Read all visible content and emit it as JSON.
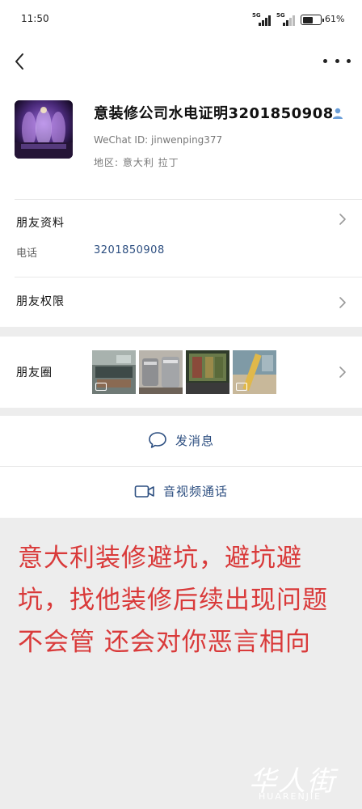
{
  "status_bar": {
    "time": "11:50",
    "signal_1_label": "5G",
    "signal_2_label": "5G",
    "battery_percent": "61%",
    "battery_level": 0.61
  },
  "profile": {
    "name": "意装修公司水电证明3201850908",
    "wechat_id": "WeChat ID: jinwenping377",
    "region": "地区: 意大利 拉丁"
  },
  "friend_info": {
    "label": "朋友资料",
    "phone_label": "电话",
    "phone_value": "3201850908"
  },
  "permissions": {
    "label": "朋友权限"
  },
  "moments": {
    "label": "朋友圈"
  },
  "actions": {
    "message_label": "发消息",
    "call_label": "音视频通话"
  },
  "overlay": {
    "text": "意大利装修避坑，避坑避坑，找他装修后续出现问题不会管 还会对你恶言相向"
  },
  "watermark": {
    "main": "华人街",
    "sub": "HUARENJIE"
  },
  "colors": {
    "link_blue": "#2c4e80",
    "overlay_red": "#d93a3a",
    "section_gap": "#ededed"
  }
}
